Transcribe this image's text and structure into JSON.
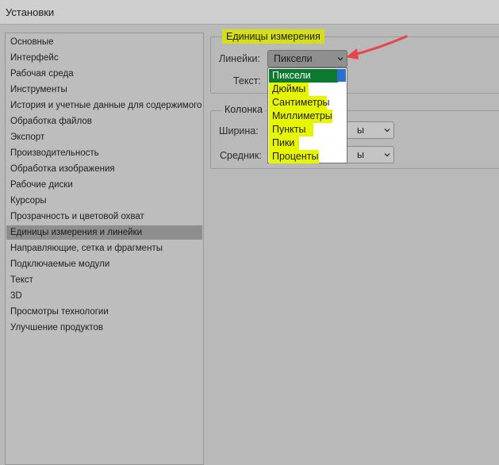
{
  "window": {
    "title": "Установки"
  },
  "sidebar": {
    "items": [
      {
        "label": "Основные"
      },
      {
        "label": "Интерфейс"
      },
      {
        "label": "Рабочая среда"
      },
      {
        "label": "Инструменты"
      },
      {
        "label": "История и учетные данные для содержимого"
      },
      {
        "label": "Обработка файлов"
      },
      {
        "label": "Экспорт"
      },
      {
        "label": "Производительность"
      },
      {
        "label": "Обработка изображения"
      },
      {
        "label": "Рабочие диски"
      },
      {
        "label": "Курсоры"
      },
      {
        "label": "Прозрачность и цветовой охват"
      },
      {
        "label": "Единицы измерения и линейки",
        "selected": true
      },
      {
        "label": "Направляющие, сетка и фрагменты"
      },
      {
        "label": "Подключаемые модули"
      },
      {
        "label": "Текст"
      },
      {
        "label": "3D"
      },
      {
        "label": "Просмотры технологии"
      },
      {
        "label": "Улучшение продуктов"
      }
    ]
  },
  "units": {
    "group_title": "Единицы измерения",
    "rulers_label": "Линейки:",
    "rulers_value": "Пиксели",
    "type_label": "Текст:",
    "dropdown_options": [
      "Пиксели",
      "Дюймы",
      "Сантиметры",
      "Миллиметры",
      "Пункты",
      "Пики",
      "Проценты"
    ],
    "selected_option": "Пиксели"
  },
  "column": {
    "group_title": "Колонка",
    "width_label": "Ширина:",
    "width_unit_suffix": "ы",
    "gutter_label": "Средник:",
    "gutter_unit_suffix": "ы"
  },
  "colors": {
    "highlight": "#e6f500",
    "selected_option": "#0b7a2f",
    "annotation_arrow": "#e8454a"
  }
}
